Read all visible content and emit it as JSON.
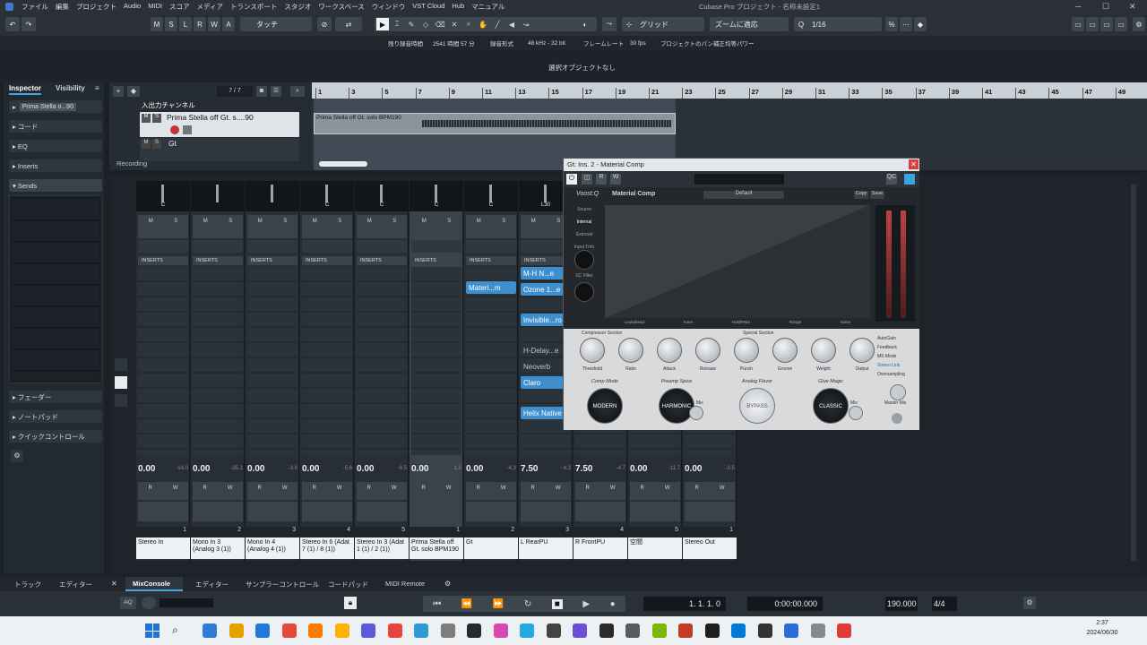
{
  "titlebar": {
    "menus": [
      "ファイル",
      "編集",
      "プロジェクト",
      "Audio",
      "MIDI",
      "スコア",
      "メディア",
      "トランスポート",
      "スタジオ",
      "ワークスペース",
      "ウィンドウ",
      "VST Cloud",
      "Hub",
      "マニュアル"
    ],
    "title": "Cubase Pro プロジェクト - 名称未設定1"
  },
  "toolbar": {
    "m": "M",
    "s": "S",
    "l": "L",
    "r": "R",
    "w": "W",
    "a": "A",
    "automation_mode": "タッチ",
    "snap": "グリッド",
    "zoom_mode": "ズームに適応",
    "quantize": "1/16"
  },
  "info": {
    "rec_time_label": "残り録音時間",
    "rec_time": "2541 時間 57 分",
    "rec_format_label": "録音形式",
    "rec_format": "48 kHz - 32 bit",
    "framerate_label": "フレームレート",
    "framerate": "30 fps",
    "pan_label": "プロジェクトのパン補正",
    "pan": "均等パワー"
  },
  "status": "選択オブジェクトなし",
  "inspector": {
    "tab1": "Inspector",
    "tab2": "Visibility",
    "track": "Prima Stella o...90",
    "sections": [
      "コード",
      "EQ",
      "Inserts",
      "Sends"
    ],
    "bottom": [
      "フェーダー",
      "ノートパッド",
      "クイックコントロール"
    ]
  },
  "tracklist": {
    "count": "7 / 7",
    "folder": "入出力チャンネル",
    "track1": "Prima Stella off Gt. s....90",
    "track2": "Gt",
    "recording": "Recording"
  },
  "ruler": [
    "1",
    "3",
    "5",
    "7",
    "9",
    "11",
    "13",
    "15",
    "17",
    "19",
    "21",
    "23",
    "25",
    "27",
    "29",
    "31",
    "33",
    "35",
    "37",
    "39",
    "41",
    "43",
    "45",
    "47",
    "49"
  ],
  "clip_name": "Prima Stella off Gt. solo BPM190",
  "mixer": {
    "strips": [
      {
        "name": "Stereo In",
        "num": "1",
        "vol": "0.00",
        "peak": "-14.0",
        "pan": "C"
      },
      {
        "name": "Mono In 3 (Analog 3 (1))",
        "num": "2",
        "vol": "0.00",
        "peak": "-35.1",
        "pan": ""
      },
      {
        "name": "Mono In 4 (Analog 4 (1))",
        "num": "3",
        "vol": "0.00",
        "peak": "-3.6",
        "pan": ""
      },
      {
        "name": "Stereo In 6 (Adat 7 (1) / 8 (1))",
        "num": "4",
        "vol": "0.00",
        "peak": "-5.6",
        "pan": "C"
      },
      {
        "name": "Stereo In 3 (Adat 1 (1) / 2 (1))",
        "num": "5",
        "vol": "0.00",
        "peak": "-6.5",
        "pan": "C"
      },
      {
        "name": "Prima Stella off Gt. solo BPM190",
        "num": "1",
        "vol": "0.00",
        "peak": "1.0",
        "pan": "C"
      },
      {
        "name": "Gt",
        "num": "2",
        "vol": "0.00",
        "peak": "-4.3",
        "pan": "C"
      },
      {
        "name": "L RearPU",
        "num": "3",
        "vol": "7.50",
        "peak": "-4.3",
        "pan": "L30"
      },
      {
        "name": "R FrontPU",
        "num": "4",
        "vol": "7.50",
        "peak": "-4.7",
        "pan": ""
      },
      {
        "name": "空間",
        "num": "5",
        "vol": "0.00",
        "peak": "-11.7",
        "pan": ""
      },
      {
        "name": "Stereo Out",
        "num": "1",
        "vol": "0.00",
        "peak": "-0.5",
        "pan": ""
      }
    ],
    "inserts_label": "INSERTS",
    "gt_inserts": [
      "Materi...m"
    ],
    "lrear_inserts": [
      "M-H N...e",
      "Ozone 1...e",
      "Invisible...ro",
      "H-Delay...e",
      "Neoverb",
      "Claro",
      "Helix Native"
    ]
  },
  "plugin": {
    "title": "Gt: Ins. 2 - Material Comp",
    "brand": "Voost:Q",
    "name": "Material Comp",
    "preset": "Default",
    "copy": "Copy",
    "save": "Save",
    "side": [
      "Source",
      "Internal",
      "External",
      "Input Trim",
      "SC Filter"
    ],
    "meter_labels": [
      "Lookahead",
      "Knee",
      "Hold/RMS",
      "Range",
      "Noise"
    ],
    "sections": [
      "Compressor Section",
      "Special Section"
    ],
    "knobs": [
      "Threshold",
      "Ratio",
      "Attack",
      "Release",
      "Punch",
      "Groove",
      "Weight",
      "Output"
    ],
    "options": [
      "AutoGain",
      "Feedback",
      "MS Mode",
      "Stereo Link",
      "Oversampling"
    ],
    "modes": [
      "Comp Mode",
      "Preamp Spice",
      "Analog Flavor",
      "Glue Magic"
    ],
    "buttons": [
      "MODERN",
      "HARMONIC",
      "BYPASS",
      "CLASSIC"
    ],
    "mix": "Mix",
    "master_mix": "Master Mix"
  },
  "bottom_tabs": [
    "トラック",
    "エディター",
    "MixConsole",
    "エディター",
    "サンプラーコントロール",
    "コードパッド",
    "MIDI Remote"
  ],
  "transport": {
    "position": "1. 1. 1.  0",
    "time": "0:00:00.000",
    "tempo": "190.000",
    "signature": "4/4"
  },
  "taskbar": {
    "time": "2:37",
    "date": "2024/06/30"
  }
}
